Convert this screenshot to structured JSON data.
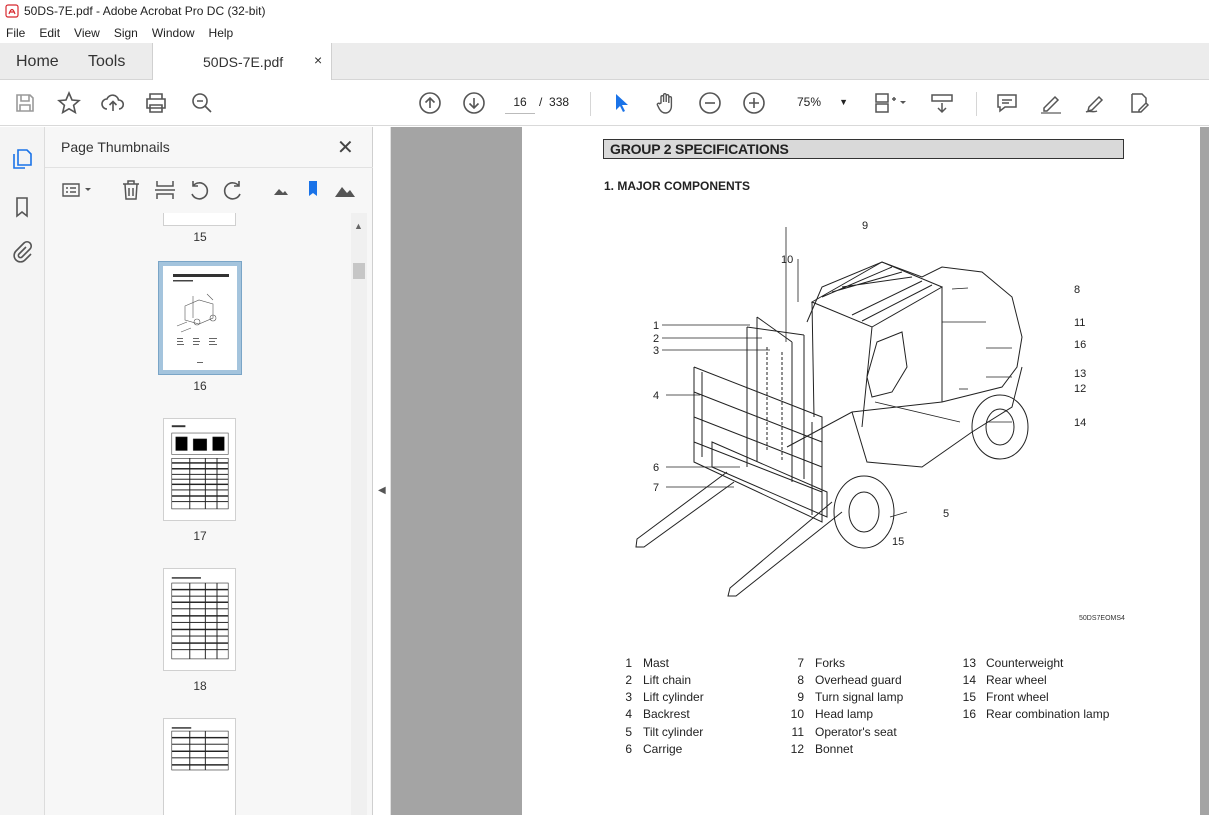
{
  "window": {
    "title": "50DS-7E.pdf - Adobe Acrobat Pro DC (32-bit)"
  },
  "menu": [
    "File",
    "Edit",
    "View",
    "Sign",
    "Window",
    "Help"
  ],
  "tabs": {
    "home": "Home",
    "tools": "Tools",
    "document": "50DS-7E.pdf",
    "close_glyph": "×"
  },
  "toolbar": {
    "current_page": "16",
    "page_separator": "/",
    "total_pages": "338",
    "zoom": "75%"
  },
  "panel": {
    "title": "Page Thumbnails",
    "close_glyph": "✕",
    "thumbnails": [
      {
        "label": "15"
      },
      {
        "label": "16"
      },
      {
        "label": "17"
      },
      {
        "label": "18"
      }
    ]
  },
  "page": {
    "group_title": "GROUP 2  SPECIFICATIONS",
    "section_title": "1. MAJOR COMPONENTS",
    "figure_code": "50DS7EOMS4",
    "callouts": [
      "1",
      "2",
      "3",
      "4",
      "5",
      "6",
      "7",
      "8",
      "9",
      "10",
      "11",
      "12",
      "13",
      "14",
      "15",
      "16"
    ],
    "components": [
      {
        "num": "1",
        "name": "Mast"
      },
      {
        "num": "2",
        "name": "Lift chain"
      },
      {
        "num": "3",
        "name": "Lift cylinder"
      },
      {
        "num": "4",
        "name": "Backrest"
      },
      {
        "num": "5",
        "name": "Tilt cylinder"
      },
      {
        "num": "6",
        "name": "Carrige"
      },
      {
        "num": "7",
        "name": "Forks"
      },
      {
        "num": "8",
        "name": "Overhead guard"
      },
      {
        "num": "9",
        "name": "Turn signal lamp"
      },
      {
        "num": "10",
        "name": "Head lamp"
      },
      {
        "num": "11",
        "name": "Operator's seat"
      },
      {
        "num": "12",
        "name": "Bonnet"
      },
      {
        "num": "13",
        "name": "Counterweight"
      },
      {
        "num": "14",
        "name": "Rear wheel"
      },
      {
        "num": "15",
        "name": "Front wheel"
      },
      {
        "num": "16",
        "name": "Rear combination lamp"
      }
    ]
  },
  "colors": {
    "accent": "#1a73e8",
    "doc_background": "#a4a4a4",
    "acrobat_red": "#d7282f",
    "selection": "#a4c4dd"
  }
}
